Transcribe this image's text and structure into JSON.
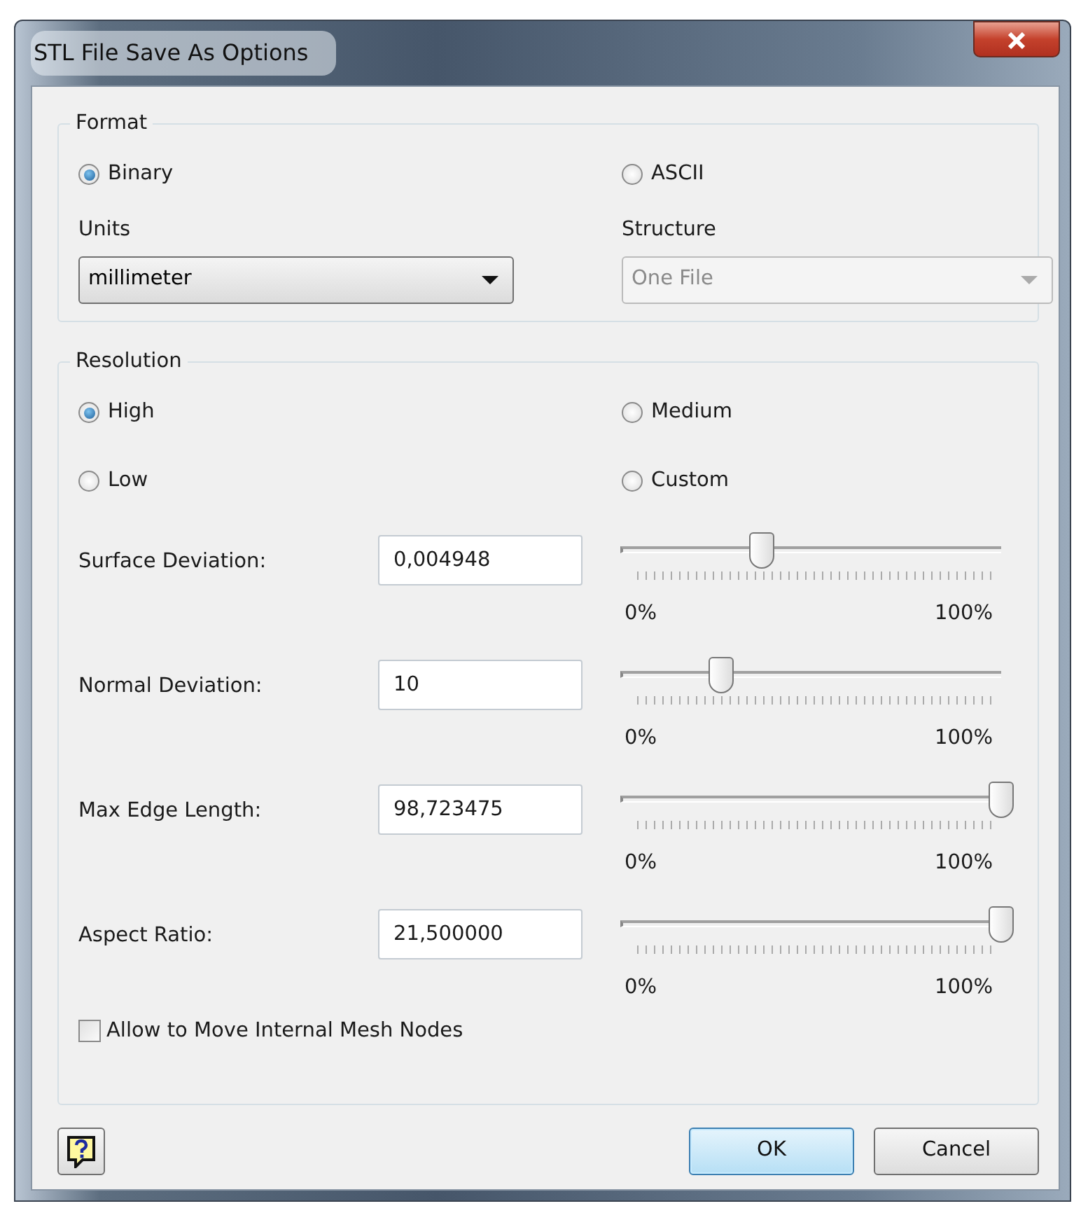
{
  "window": {
    "title": "STL File Save As Options"
  },
  "format": {
    "label": "Format",
    "options": [
      {
        "label": "Binary",
        "selected": true
      },
      {
        "label": "ASCII",
        "selected": false
      }
    ],
    "units": {
      "label": "Units",
      "value": "millimeter",
      "disabled": false
    },
    "structure": {
      "label": "Structure",
      "value": "One File",
      "disabled": true
    }
  },
  "resolution": {
    "label": "Resolution",
    "options": [
      {
        "label": "High",
        "selected": true
      },
      {
        "label": "Medium",
        "selected": false
      },
      {
        "label": "Low",
        "selected": false
      },
      {
        "label": "Custom",
        "selected": false
      }
    ],
    "parameters": [
      {
        "label": "Surface Deviation:",
        "value": "0,004948",
        "level": 0.35,
        "min_label": "0%",
        "max_label": "100%"
      },
      {
        "label": "Normal Deviation:",
        "value": "10",
        "level": 0.24,
        "min_label": "0%",
        "max_label": "100%"
      },
      {
        "label": "Max Edge Length:",
        "value": "98,723475",
        "level": 1,
        "min_label": "0%",
        "max_label": "100%"
      },
      {
        "label": "Aspect Ratio:",
        "value": "21,500000",
        "level": 1,
        "min_label": "0%",
        "max_label": "100%"
      }
    ],
    "checkbox": {
      "label": "Allow to Move Internal Mesh Nodes",
      "checked": false
    }
  },
  "buttons": [
    {
      "label": "OK",
      "default": true
    },
    {
      "label": "Cancel",
      "default": false
    }
  ]
}
